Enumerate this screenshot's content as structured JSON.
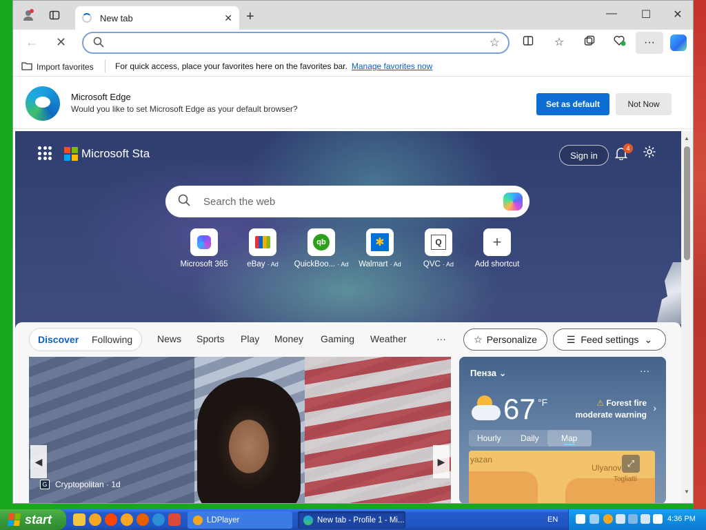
{
  "browser": {
    "tab_title": "New tab",
    "address_placeholder": "",
    "favorites_bar": {
      "import_label": "Import favorites",
      "message": "For quick access, place your favorites here on the favorites bar.",
      "manage_link": "Manage favorites now"
    }
  },
  "banner": {
    "title": "Microsoft Edge",
    "subtitle": "Would you like to set Microsoft Edge as your default browser?",
    "set_default_label": "Set as default",
    "not_now_label": "Not Now"
  },
  "ntp": {
    "brand": "Microsoft Sta",
    "sign_in_label": "Sign in",
    "notification_count": "4",
    "search_placeholder": "Search the web",
    "shortcuts": [
      {
        "label": "Microsoft 365",
        "ad": ""
      },
      {
        "label": "eBay",
        "ad": "· Ad"
      },
      {
        "label": "QuickBoo...",
        "ad": "· Ad"
      },
      {
        "label": "Walmart",
        "ad": "· Ad"
      },
      {
        "label": "QVC",
        "ad": "· Ad"
      },
      {
        "label": "Add shortcut",
        "ad": ""
      }
    ],
    "feed_tabs": {
      "discover": "Discover",
      "following": "Following",
      "categories": [
        "News",
        "Sports",
        "Play",
        "Money",
        "Gaming",
        "Weather"
      ],
      "more": "···"
    },
    "personalize_label": "Personalize",
    "feed_settings_label": "Feed settings",
    "hero": {
      "source": "Cryptopolitan · 1d"
    },
    "weather": {
      "city": "Пенза",
      "temperature": "67",
      "unit": "°F",
      "warning_line1": "Forest fire",
      "warning_line2": "moderate warning",
      "tabs": [
        "Hourly",
        "Daily",
        "Map"
      ],
      "map_labels": [
        "yazan",
        "Ulyanov",
        "Togliatti"
      ]
    }
  },
  "taskbar": {
    "start_label": "start",
    "tasks": [
      {
        "label": "LDPlayer"
      },
      {
        "label": "New tab - Profile 1 - Mi..."
      }
    ],
    "language": "EN",
    "clock": "4:36 PM"
  },
  "colors": {
    "accent": "#0c6dd3",
    "link": "#0c5fc4",
    "taskbar": "#2459c8",
    "start": "#3a9a3a"
  }
}
